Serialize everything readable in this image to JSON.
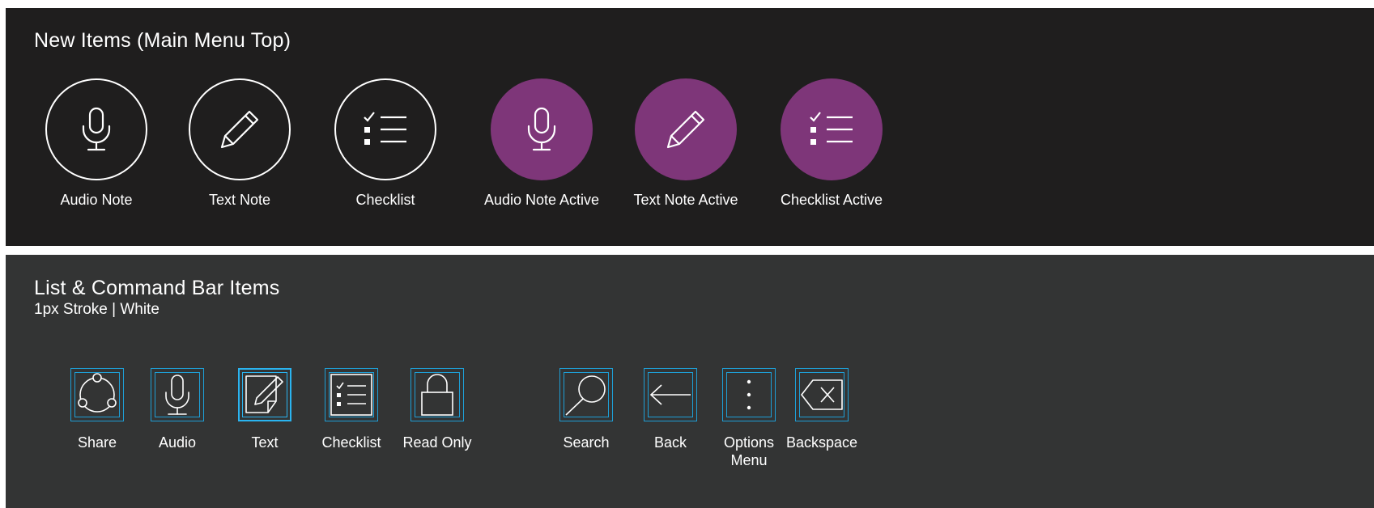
{
  "top_panel": {
    "title": "New Items (Main Menu Top)",
    "items": [
      {
        "label": "Audio Note",
        "icon": "microphone-icon",
        "state": "default"
      },
      {
        "label": "Text Note",
        "icon": "pencil-icon",
        "state": "default"
      },
      {
        "label": "Checklist",
        "icon": "checklist-icon",
        "state": "default"
      },
      {
        "label": "Audio Note Active",
        "icon": "microphone-icon",
        "state": "active"
      },
      {
        "label": "Text Note Active",
        "icon": "pencil-icon",
        "state": "active"
      },
      {
        "label": "Checklist Active",
        "icon": "checklist-icon",
        "state": "active"
      }
    ]
  },
  "bottom_panel": {
    "title": "List & Command Bar Items",
    "subtitle": "1px Stroke | White",
    "items": [
      {
        "label": "Share",
        "icon": "share-icon"
      },
      {
        "label": "Audio",
        "icon": "microphone-icon"
      },
      {
        "label": "Text",
        "icon": "note-edit-icon",
        "state": "selected"
      },
      {
        "label": "Checklist",
        "icon": "checklist-icon"
      },
      {
        "label": "Read Only",
        "icon": "lock-icon"
      },
      {
        "label": "Search",
        "icon": "search-icon"
      },
      {
        "label": "Back",
        "icon": "back-arrow-icon"
      },
      {
        "label": "Options Menu",
        "icon": "more-vertical-icon"
      },
      {
        "label": "Backspace",
        "icon": "backspace-icon"
      }
    ]
  },
  "colors": {
    "top_background": "#1f1e1e",
    "bottom_background": "#333434",
    "active_purple": "#7e3679",
    "outline_blue": "#1e9fd6",
    "text_white": "#ffffff"
  }
}
